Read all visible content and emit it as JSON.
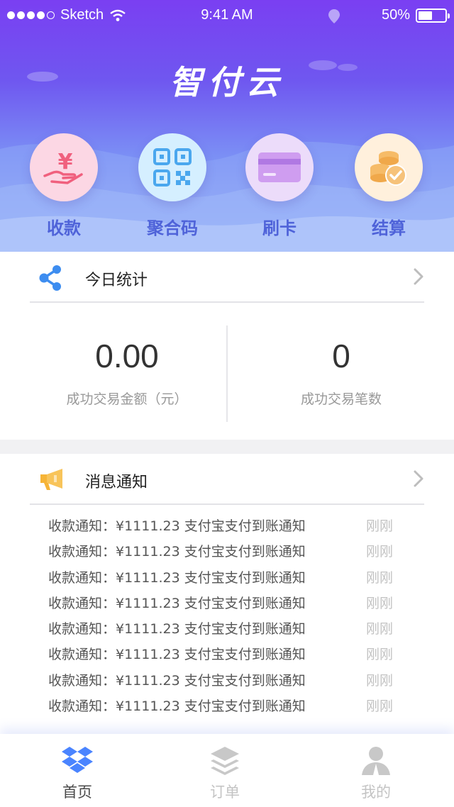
{
  "status_bar": {
    "carrier": "Sketch",
    "time": "9:41 AM",
    "battery": "50%",
    "battery_level": 0.5,
    "signal_icon": "signal-dots-icon",
    "wifi_icon": "wifi-icon",
    "location_icon": "location-icon"
  },
  "brand": {
    "logo_text": "智付云"
  },
  "quick_actions": [
    {
      "label": "收款",
      "icon": "hand-yuan-icon",
      "bg": "#fcd7e4"
    },
    {
      "label": "聚合码",
      "icon": "qr-code-icon",
      "bg": "#d5efff"
    },
    {
      "label": "刷卡",
      "icon": "bank-card-icon",
      "bg": "#ecdcfa"
    },
    {
      "label": "结算",
      "icon": "coins-check-icon",
      "bg": "#fff0dc"
    }
  ],
  "stats": {
    "title": "今日统计",
    "icon": "share-icon",
    "amount_value": "0.00",
    "amount_label": "成功交易金额（元）",
    "count_value": "0",
    "count_label": "成功交易笔数"
  },
  "notices": {
    "title": "消息通知",
    "icon": "megaphone-icon",
    "items": [
      {
        "text": "收款通知：¥1111.23  支付宝支付到账通知",
        "time": "刚刚"
      },
      {
        "text": "收款通知：¥1111.23  支付宝支付到账通知",
        "time": "刚刚"
      },
      {
        "text": "收款通知：¥1111.23  支付宝支付到账通知",
        "time": "刚刚"
      },
      {
        "text": "收款通知：¥1111.23  支付宝支付到账通知",
        "time": "刚刚"
      },
      {
        "text": "收款通知：¥1111.23  支付宝支付到账通知",
        "time": "刚刚"
      },
      {
        "text": "收款通知：¥1111.23  支付宝支付到账通知",
        "time": "刚刚"
      },
      {
        "text": "收款通知：¥1111.23  支付宝支付到账通知",
        "time": "刚刚"
      },
      {
        "text": "收款通知：¥1111.23  支付宝支付到账通知",
        "time": "刚刚"
      }
    ]
  },
  "tabs": [
    {
      "label": "首页",
      "icon": "dropbox-box-icon",
      "active": true
    },
    {
      "label": "订单",
      "icon": "layers-icon",
      "active": false
    },
    {
      "label": "我的",
      "icon": "user-icon",
      "active": false
    }
  ],
  "colors": {
    "header_top": "#7a3ff2",
    "header_bottom": "#a8c3fb",
    "accent_blue": "#4f63d9",
    "tab_active": "#4a84ff",
    "tab_inactive": "#c8c8c8"
  }
}
